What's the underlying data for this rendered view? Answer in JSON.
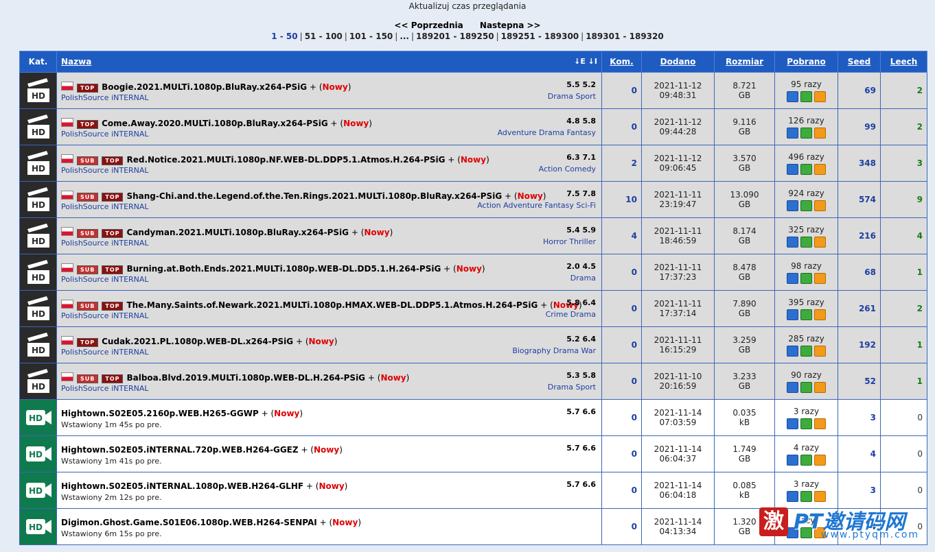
{
  "header": {
    "refresh_text": "Aktualizuj czas przeglądania",
    "prev": "<< Poprzednia",
    "next": "Nastepna >>",
    "pages": [
      "1 - 50",
      "51 - 100",
      "101 - 150",
      "...",
      "189201 - 189250",
      "189251 - 189300",
      "189301 - 189320"
    ],
    "current_page": "1 - 50"
  },
  "columns": {
    "kat": "Kat.",
    "nazwa": "Nazwa",
    "sort_icons": "↓E ↓I",
    "kom": "Kom.",
    "dodano": "Dodano",
    "rozmiar": "Rozmiar",
    "pobrano": "Pobrano",
    "seed": "Seed",
    "leech": "Leech"
  },
  "colors": {
    "header_bg": "#1f5cc2",
    "row_gray": "#dcdcdc",
    "new_red": "#e00000",
    "link_blue": "#1c3fa0",
    "leech_green": "#1a7a1a"
  },
  "rows": [
    {
      "cat": "hd-movie",
      "flag": true,
      "sub": false,
      "top": true,
      "title": "Boogie.2021.MULTi.1080p.BluRay.x264-PSiG",
      "plus": "+",
      "nowy_open": "(",
      "nowy": "Nowy",
      "nowy_close": ")",
      "source": "PolishSource iNTERNAL",
      "rating": "5.5 5.2",
      "genre": "Drama Sport",
      "kom": "0",
      "date": "2021-11-12",
      "time": "09:48:31",
      "size": "8.721",
      "unit": "GB",
      "pobrano": "95 razy",
      "seed": "69",
      "leech": "2"
    },
    {
      "cat": "hd-movie",
      "flag": true,
      "sub": false,
      "top": true,
      "title": "Come.Away.2020.MULTi.1080p.BluRay.x264-PSiG",
      "plus": "+",
      "nowy_open": "(",
      "nowy": "Nowy",
      "nowy_close": ")",
      "source": "PolishSource iNTERNAL",
      "rating": "4.8 5.8",
      "genre": "Adventure Drama Fantasy",
      "kom": "0",
      "date": "2021-11-12",
      "time": "09:44:28",
      "size": "9.116",
      "unit": "GB",
      "pobrano": "126 razy",
      "seed": "99",
      "leech": "2"
    },
    {
      "cat": "hd-movie",
      "flag": true,
      "sub": true,
      "top": true,
      "title": "Red.Notice.2021.MULTi.1080p.NF.WEB-DL.DDP5.1.Atmos.H.264-PSiG",
      "plus": "+",
      "nowy_open": "(",
      "nowy": "Nowy",
      "nowy_close": ")",
      "source": "PolishSource iNTERNAL",
      "rating": "6.3 7.1",
      "genre": "Action Comedy",
      "kom": "2",
      "date": "2021-11-12",
      "time": "09:06:45",
      "size": "3.570",
      "unit": "GB",
      "pobrano": "496 razy",
      "seed": "348",
      "leech": "3"
    },
    {
      "cat": "hd-movie",
      "flag": true,
      "sub": true,
      "top": true,
      "title": "Shang-Chi.and.the.Legend.of.the.Ten.Rings.2021.MULTi.1080p.BluRay.x264-PSiG",
      "plus": "+",
      "nowy_open": "(",
      "nowy": "Nowy",
      "nowy_close": ")",
      "source": "PolishSource iNTERNAL",
      "rating": "7.5 7.8",
      "genre": "Action Adventure Fantasy Sci-Fi",
      "kom": "10",
      "date": "2021-11-11",
      "time": "23:19:47",
      "size": "13.090",
      "unit": "GB",
      "pobrano": "924 razy",
      "seed": "574",
      "leech": "9"
    },
    {
      "cat": "hd-movie",
      "flag": true,
      "sub": true,
      "top": true,
      "title": "Candyman.2021.MULTi.1080p.BluRay.x264-PSiG",
      "plus": "+",
      "nowy_open": "(",
      "nowy": "Nowy",
      "nowy_close": ")",
      "source": "PolishSource iNTERNAL",
      "rating": "5.4 5.9",
      "genre": "Horror Thriller",
      "kom": "4",
      "date": "2021-11-11",
      "time": "18:46:59",
      "size": "8.174",
      "unit": "GB",
      "pobrano": "325 razy",
      "seed": "216",
      "leech": "4"
    },
    {
      "cat": "hd-movie",
      "flag": true,
      "sub": true,
      "top": true,
      "title": "Burning.at.Both.Ends.2021.MULTi.1080p.WEB-DL.DD5.1.H.264-PSiG",
      "plus": "+",
      "nowy_open": "(",
      "nowy": "Nowy",
      "nowy_close": ")",
      "source": "PolishSource iNTERNAL",
      "rating": "2.0 4.5",
      "genre": "Drama",
      "kom": "0",
      "date": "2021-11-11",
      "time": "17:37:23",
      "size": "8.478",
      "unit": "GB",
      "pobrano": "98 razy",
      "seed": "68",
      "leech": "1"
    },
    {
      "cat": "hd-movie",
      "flag": true,
      "sub": true,
      "top": true,
      "title": "The.Many.Saints.of.Newark.2021.MULTi.1080p.HMAX.WEB-DL.DDP5.1.Atmos.H.264-PSiG",
      "plus": "+",
      "nowy_open": "(",
      "nowy": "Nowy",
      "nowy_close": ")",
      "source": "PolishSource iNTERNAL",
      "rating": "5.8 6.4",
      "genre": "Crime Drama",
      "kom": "0",
      "date": "2021-11-11",
      "time": "17:37:14",
      "size": "7.890",
      "unit": "GB",
      "pobrano": "395 razy",
      "seed": "261",
      "leech": "2"
    },
    {
      "cat": "hd-movie",
      "flag": true,
      "sub": false,
      "top": true,
      "title": "Cudak.2021.PL.1080p.WEB-DL.x264-PSiG",
      "plus": "+",
      "nowy_open": "(",
      "nowy": "Nowy",
      "nowy_close": ")",
      "source": "PolishSource iNTERNAL",
      "rating": "5.2 6.4",
      "genre": "Biography Drama War",
      "kom": "0",
      "date": "2021-11-11",
      "time": "16:15:29",
      "size": "3.259",
      "unit": "GB",
      "pobrano": "285 razy",
      "seed": "192",
      "leech": "1"
    },
    {
      "cat": "hd-movie",
      "flag": true,
      "sub": true,
      "top": true,
      "title": "Balboa.Blvd.2019.MULTi.1080p.WEB-DL.H.264-PSiG",
      "plus": "+",
      "nowy_open": "(",
      "nowy": "Nowy",
      "nowy_close": ")",
      "source": "PolishSource iNTERNAL",
      "rating": "5.3 5.8",
      "genre": "Drama Sport",
      "kom": "0",
      "date": "2021-11-10",
      "time": "20:16:59",
      "size": "3.233",
      "unit": "GB",
      "pobrano": "90 razy",
      "seed": "52",
      "leech": "1"
    },
    {
      "cat": "hd-tv",
      "flag": false,
      "sub": false,
      "top": false,
      "title": "Hightown.S02E05.2160p.WEB.H265-GGWP",
      "plus": "+",
      "nowy_open": "(",
      "nowy": "Nowy",
      "nowy_close": ")",
      "source": "Wstawiony 1m 45s po pre.",
      "rating": "5.7 6.6",
      "genre": "",
      "kom": "0",
      "date": "2021-11-14",
      "time": "07:03:59",
      "size": "0.035",
      "unit": "kB",
      "pobrano": "3 razy",
      "seed": "3",
      "leech": "0"
    },
    {
      "cat": "hd-tv",
      "flag": false,
      "sub": false,
      "top": false,
      "title": "Hightown.S02E05.iNTERNAL.720p.WEB.H264-GGEZ",
      "plus": "+",
      "nowy_open": "(",
      "nowy": "Nowy",
      "nowy_close": ")",
      "source": "Wstawiony 1m 41s po pre.",
      "rating": "5.7 6.6",
      "genre": "",
      "kom": "0",
      "date": "2021-11-14",
      "time": "06:04:37",
      "size": "1.749",
      "unit": "GB",
      "pobrano": "4 razy",
      "seed": "4",
      "leech": "0"
    },
    {
      "cat": "hd-tv",
      "flag": false,
      "sub": false,
      "top": false,
      "title": "Hightown.S02E05.iNTERNAL.1080p.WEB.H264-GLHF",
      "plus": "+",
      "nowy_open": "(",
      "nowy": "Nowy",
      "nowy_close": ")",
      "source": "Wstawiony 2m 12s po pre.",
      "rating": "5.7 6.6",
      "genre": "",
      "kom": "0",
      "date": "2021-11-14",
      "time": "06:04:18",
      "size": "0.085",
      "unit": "kB",
      "pobrano": "3 razy",
      "seed": "3",
      "leech": "0"
    },
    {
      "cat": "hd-tv",
      "flag": false,
      "sub": false,
      "top": false,
      "title": "Digimon.Ghost.Game.S01E06.1080p.WEB.H264-SENPAI",
      "plus": "+",
      "nowy_open": "(",
      "nowy": "Nowy",
      "nowy_close": ")",
      "source": "Wstawiony 6m 15s po pre.",
      "rating": "",
      "genre": "",
      "kom": "0",
      "date": "2021-11-14",
      "time": "04:13:34",
      "size": "1.320",
      "unit": "GB",
      "pobrano": "razy",
      "seed": "4",
      "leech": "0"
    }
  ],
  "tag_labels": {
    "top": "TOP",
    "sub": "SUB",
    "hd": "HD"
  },
  "watermark": {
    "logo": "激",
    "text": "PT邀请码网",
    "url": "www.ptyqm.com"
  }
}
